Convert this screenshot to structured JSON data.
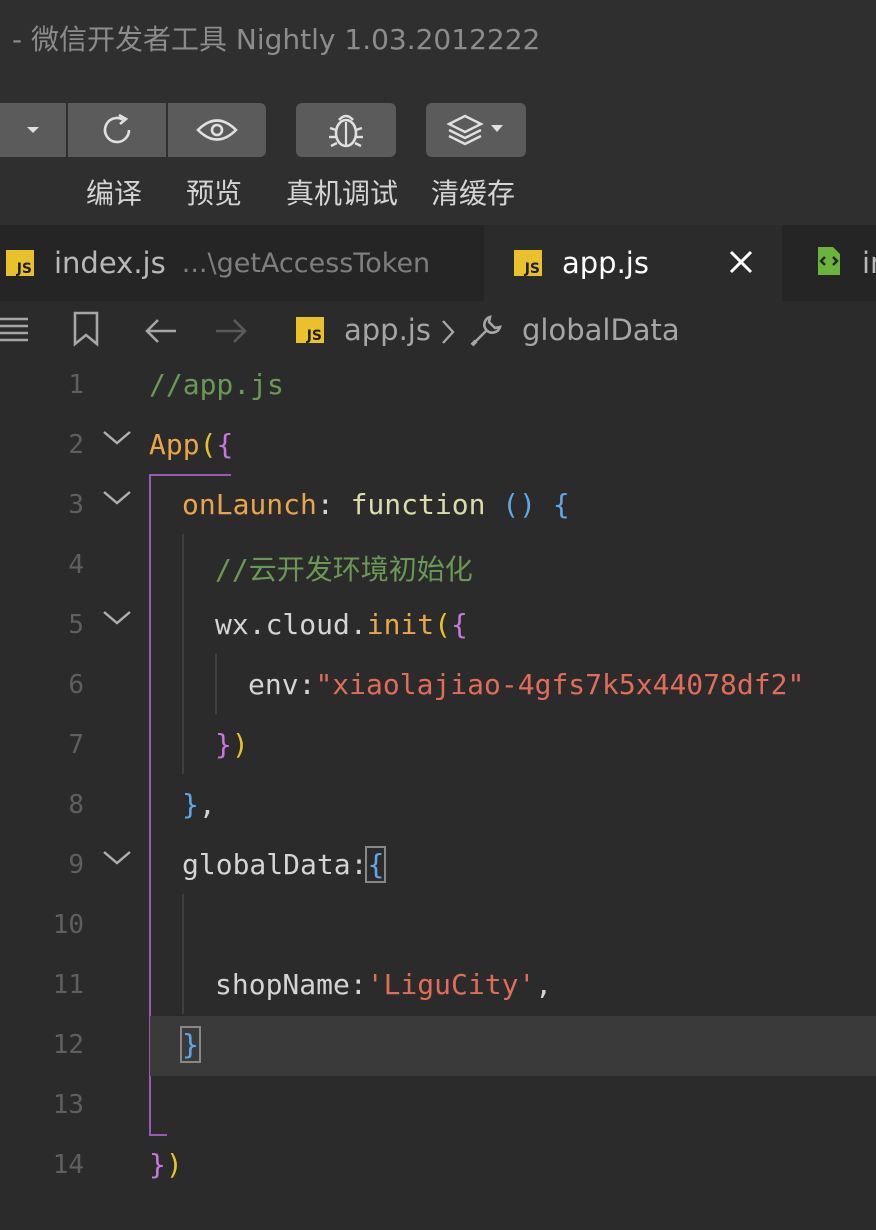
{
  "window": {
    "title": "- 微信开发者工具 Nightly 1.03.2012222"
  },
  "toolbar": {
    "buttons": [
      {
        "label": "",
        "icon": "dropdown-arrow-icon"
      },
      {
        "label": "编译",
        "icon": "refresh-icon"
      },
      {
        "label": "预览",
        "icon": "eye-icon"
      },
      {
        "label": "真机调试",
        "icon": "bug-icon"
      },
      {
        "label": "清缓存",
        "icon": "layers-icon"
      }
    ]
  },
  "tabs": [
    {
      "name": "index.js",
      "path": "...\\getAccessToken",
      "icon": "js-file-icon",
      "active": false
    },
    {
      "name": "app.js",
      "path": "",
      "icon": "js-file-icon",
      "active": true
    },
    {
      "name": "in",
      "path": "",
      "icon": "wxml-file-icon",
      "active": false
    }
  ],
  "breadcrumb": {
    "file": "app.js",
    "symbol": "globalData",
    "icons": [
      "menu-icon",
      "bookmark-icon",
      "back-arrow-icon",
      "forward-arrow-icon",
      "js-file-icon",
      "wrench-icon"
    ]
  },
  "editor": {
    "current_line": 12,
    "lines": [
      {
        "n": "1",
        "fold": false
      },
      {
        "n": "2",
        "fold": true
      },
      {
        "n": "3",
        "fold": true
      },
      {
        "n": "4",
        "fold": false
      },
      {
        "n": "5",
        "fold": true
      },
      {
        "n": "6",
        "fold": false
      },
      {
        "n": "7",
        "fold": false
      },
      {
        "n": "8",
        "fold": false
      },
      {
        "n": "9",
        "fold": true
      },
      {
        "n": "10",
        "fold": false
      },
      {
        "n": "11",
        "fold": false
      },
      {
        "n": "12",
        "fold": false
      },
      {
        "n": "13",
        "fold": false
      },
      {
        "n": "14",
        "fold": false
      }
    ],
    "code": {
      "l1_comment": "//app.js",
      "l2_app": "App",
      "l2_paren": "(",
      "l2_brace": "{",
      "l3_key": "onLaunch",
      "l3_colon": ": ",
      "l3_function": "function",
      "l3_parens": " () ",
      "l3_brace": "{",
      "l4_comment": "//云开发环境初始化",
      "l5_obj": "wx.cloud.",
      "l5_fn": "init",
      "l5_paren": "(",
      "l5_brace": "{",
      "l6_key": "env:",
      "l6_str": "\"xiaolajiao-4gfs7k5x44078df2\"",
      "l7_brace": "}",
      "l7_paren": ")",
      "l8_brace": "}",
      "l8_comma": ",",
      "l9_key": "globalData:",
      "l9_brace": "{",
      "l11_key": "shopName:",
      "l11_str": "'LiguCity'",
      "l11_comma": ",",
      "l12_brace": "}",
      "l14_brace": "}",
      "l14_paren": ")"
    }
  }
}
